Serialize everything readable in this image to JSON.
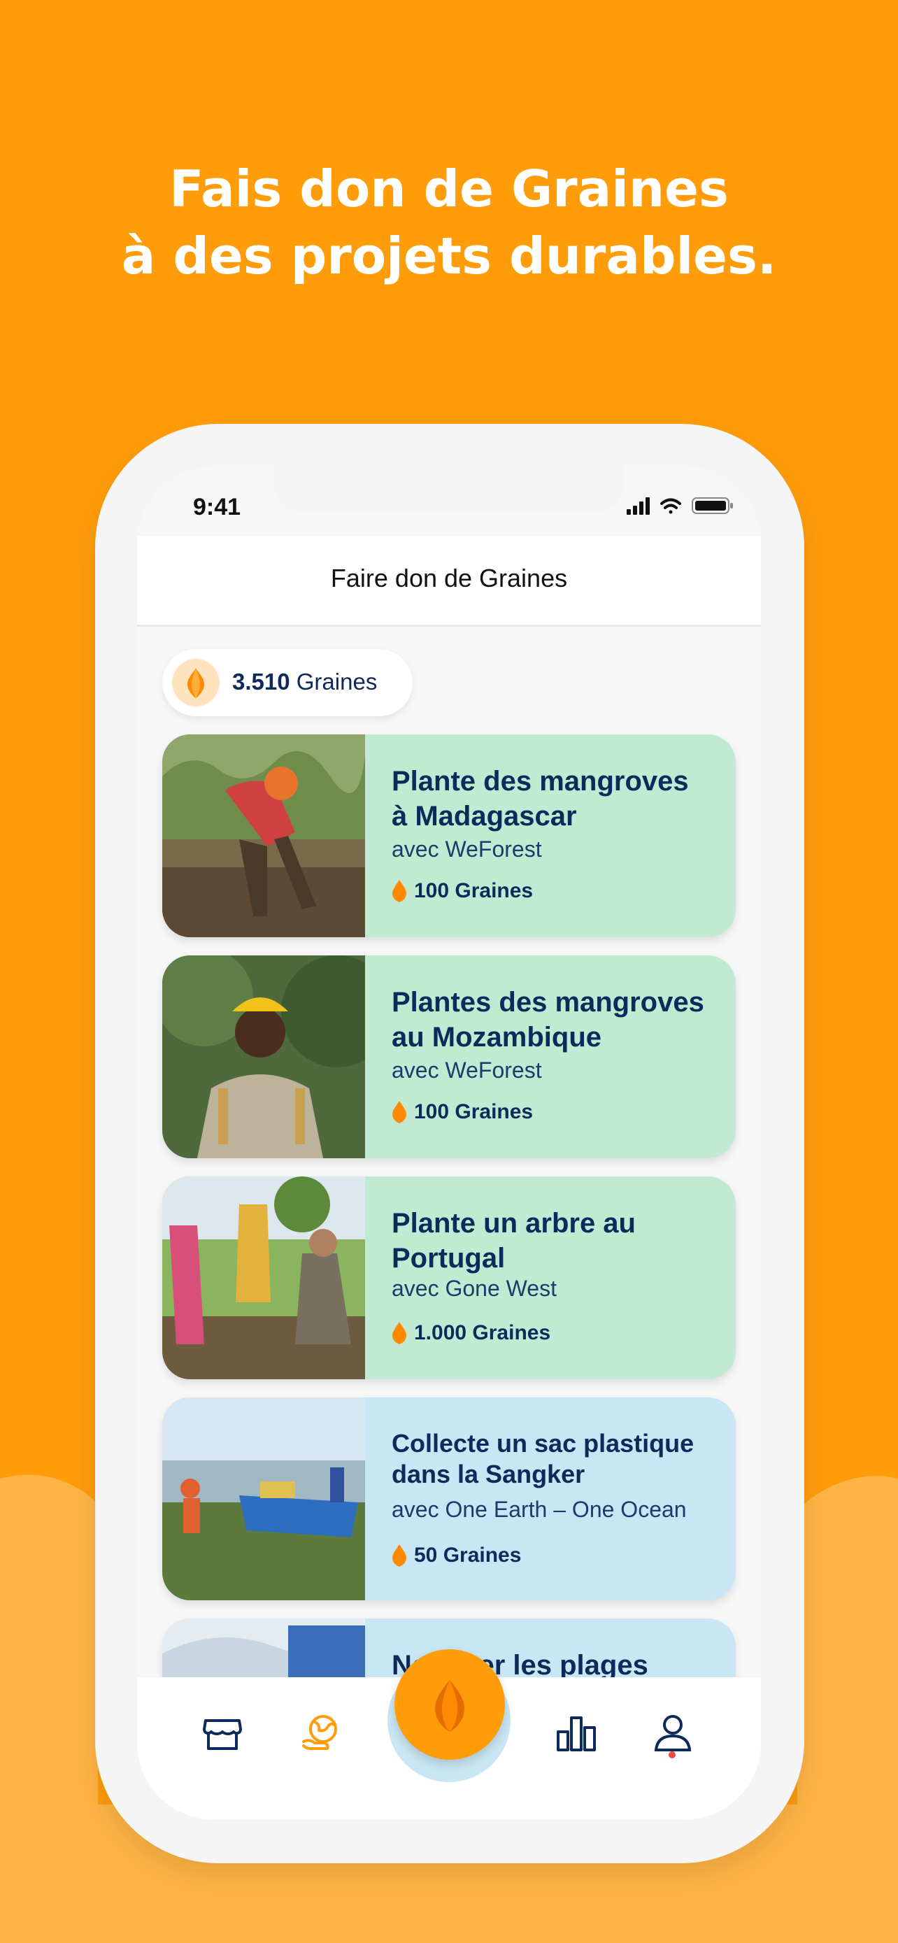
{
  "headline": {
    "line1": "Fais don de Graines",
    "line2": "à des projets durables."
  },
  "status_bar": {
    "time": "9:41"
  },
  "screen": {
    "title": "Faire don de Graines"
  },
  "balance": {
    "amount": "3.510",
    "unit": "Graines"
  },
  "projects": [
    {
      "title_line1": "Plante des mangroves",
      "title_line2": "à Madagascar",
      "partner": "avec WeForest",
      "cost": "100 Graines",
      "color": "#C2EAD2"
    },
    {
      "title_line1": "Plantes des mangroves",
      "title_line2": "au Mozambique",
      "partner": "avec WeForest",
      "cost": "100 Graines",
      "color": "#C2EAD2"
    },
    {
      "title_line1": "Plante un arbre au",
      "title_line2": "Portugal",
      "partner": "avec Gone West",
      "cost": "1.000 Graines",
      "color": "#C2EAD2"
    },
    {
      "title_line1": "Collecte un sac plastique",
      "title_line2": "dans la Sangker",
      "partner": "avec One Earth – One Ocean",
      "cost": "50 Graines",
      "color": "#C8E6F3"
    },
    {
      "title_line1": "Nettoyer les plages",
      "title_line2": "",
      "partner": "",
      "cost": "",
      "color": "#C8E6F3"
    }
  ],
  "tabbar": {
    "items": [
      {
        "icon": "store-icon",
        "active": false
      },
      {
        "icon": "earth-hand-icon",
        "active": true
      },
      {
        "icon": "seed-icon",
        "active": false
      },
      {
        "icon": "bar-chart-icon",
        "active": false
      },
      {
        "icon": "profile-icon",
        "active": false
      }
    ]
  },
  "colors": {
    "brand_orange": "#FF9C0A",
    "navy_text": "#0E2A5A",
    "card_green": "#C2EAD2",
    "card_blue": "#C8E6F3",
    "notification_dot": "#F04A3C"
  }
}
